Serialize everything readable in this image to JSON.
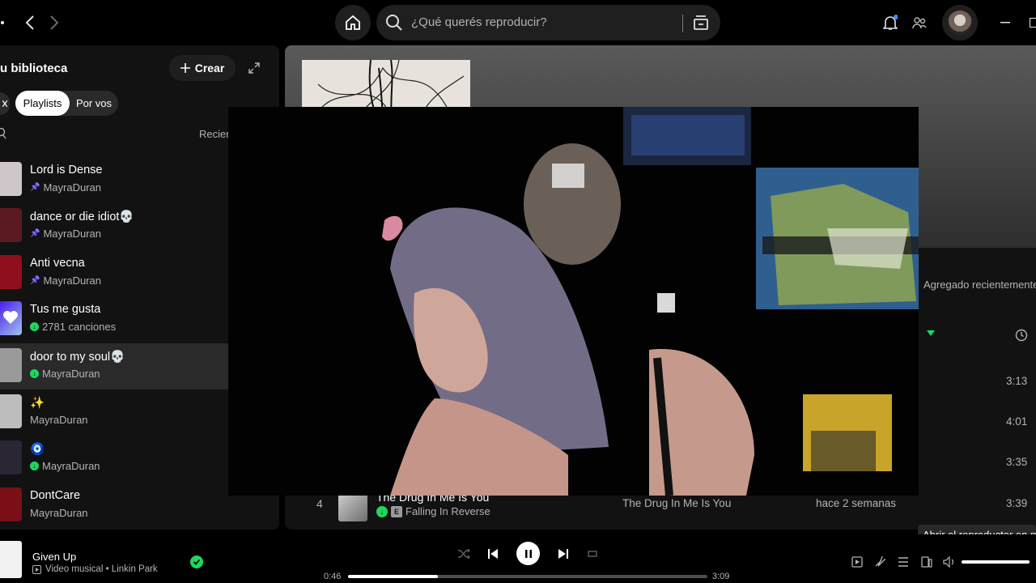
{
  "search": {
    "placeholder": "¿Qué querés reproducir?"
  },
  "sidebar": {
    "title": "u biblioteca",
    "create_label": "Crear",
    "filters": [
      "Playlists",
      "Por vos"
    ],
    "sort_label": "Recien",
    "items": [
      {
        "name": "Lord is Dense",
        "sub": "MayraDuran",
        "pinned": true,
        "downloaded": false,
        "color": "#cfc6c9"
      },
      {
        "name": "dance or die idiot💀",
        "sub": "MayraDuran",
        "pinned": true,
        "downloaded": false,
        "color": "#5b1a22"
      },
      {
        "name": "Anti vecna",
        "sub": "MayraDuran",
        "pinned": true,
        "downloaded": false,
        "color": "#8f0f1e"
      },
      {
        "name": "Tus me gusta",
        "sub": "2781 canciones",
        "pinned": false,
        "downloaded": true,
        "color": "#6f3ff5"
      },
      {
        "name": "door to my soul💀",
        "sub": "MayraDuran",
        "pinned": false,
        "downloaded": true,
        "color": "#9a9a9a"
      },
      {
        "name": "✨",
        "sub": "MayraDuran",
        "pinned": false,
        "downloaded": false,
        "color": "#bdbdbd"
      },
      {
        "name": "🧿",
        "sub": "MayraDuran",
        "pinned": false,
        "downloaded": true,
        "color": "#2a2733"
      },
      {
        "name": "DontCare",
        "sub": "MayraDuran",
        "pinned": false,
        "downloaded": false,
        "color": "#7a0f18"
      }
    ]
  },
  "main": {
    "sorted_label": "Agregado recientemente",
    "durations": [
      "3:13",
      "4:01",
      "3:35"
    ],
    "track4": {
      "number": "4",
      "title": "The Drug In Me Is You",
      "explicit": "E",
      "artist": "Falling In Reverse",
      "album": "The Drug In Me Is You",
      "added": "hace 2 semanas",
      "duration": "3:39"
    }
  },
  "tooltip": "Abrir el reproductor en m",
  "now_playing": {
    "title": "Given Up",
    "subtitle": "Video musical • Linkin Park",
    "elapsed": "0:46",
    "total": "3:09",
    "progress": 0.25,
    "volume": 1.0
  }
}
